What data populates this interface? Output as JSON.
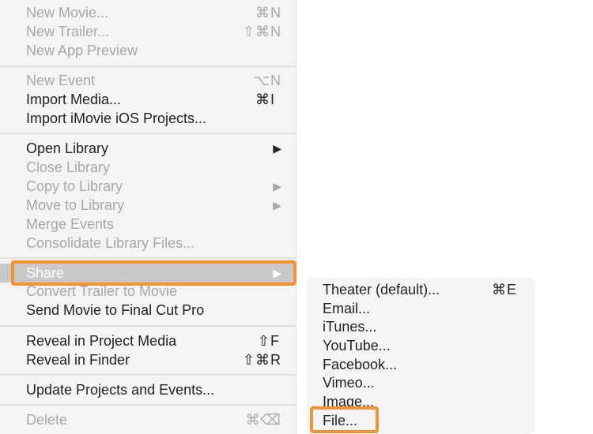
{
  "main_menu": {
    "items": [
      {
        "label": "New Movie...",
        "shortcut": "⌘N",
        "enabled": false
      },
      {
        "label": "New Trailer...",
        "shortcut": "⇧⌘N",
        "enabled": false
      },
      {
        "label": "New App Preview",
        "shortcut": "",
        "enabled": false
      },
      {
        "label": "New Event",
        "shortcut": "⌥N",
        "enabled": false
      },
      {
        "label": "Import Media...",
        "shortcut": "⌘I",
        "enabled": true
      },
      {
        "label": "Import iMovie iOS Projects...",
        "shortcut": "",
        "enabled": true
      },
      {
        "label": "Open Library",
        "submenu": true,
        "enabled": true
      },
      {
        "label": "Close Library",
        "enabled": false
      },
      {
        "label": "Copy to Library",
        "submenu": true,
        "enabled": false
      },
      {
        "label": "Move to Library",
        "submenu": true,
        "enabled": false
      },
      {
        "label": "Merge Events",
        "enabled": false
      },
      {
        "label": "Consolidate Library Files...",
        "enabled": false
      },
      {
        "label": "Share",
        "submenu": true,
        "enabled": true,
        "highlighted": true
      },
      {
        "label": "Convert Trailer to Movie",
        "enabled": false
      },
      {
        "label": "Send Movie to Final Cut Pro",
        "enabled": true
      },
      {
        "label": "Reveal in Project Media",
        "shortcut": "⇧F",
        "enabled": true
      },
      {
        "label": "Reveal in Finder",
        "shortcut": "⇧⌘R",
        "enabled": true
      },
      {
        "label": "Update Projects and Events...",
        "enabled": true
      },
      {
        "label": "Delete",
        "shortcut": "⌘⌫",
        "enabled": false
      }
    ],
    "submenu_arrow": "▶"
  },
  "share_submenu": {
    "items": [
      {
        "label": "Theater (default)...",
        "shortcut": "⌘E"
      },
      {
        "label": "Email..."
      },
      {
        "label": "iTunes..."
      },
      {
        "label": "YouTube..."
      },
      {
        "label": "Facebook..."
      },
      {
        "label": "Vimeo..."
      },
      {
        "label": "Image..."
      },
      {
        "label": "File..."
      }
    ]
  },
  "highlight_color": "#f59331"
}
